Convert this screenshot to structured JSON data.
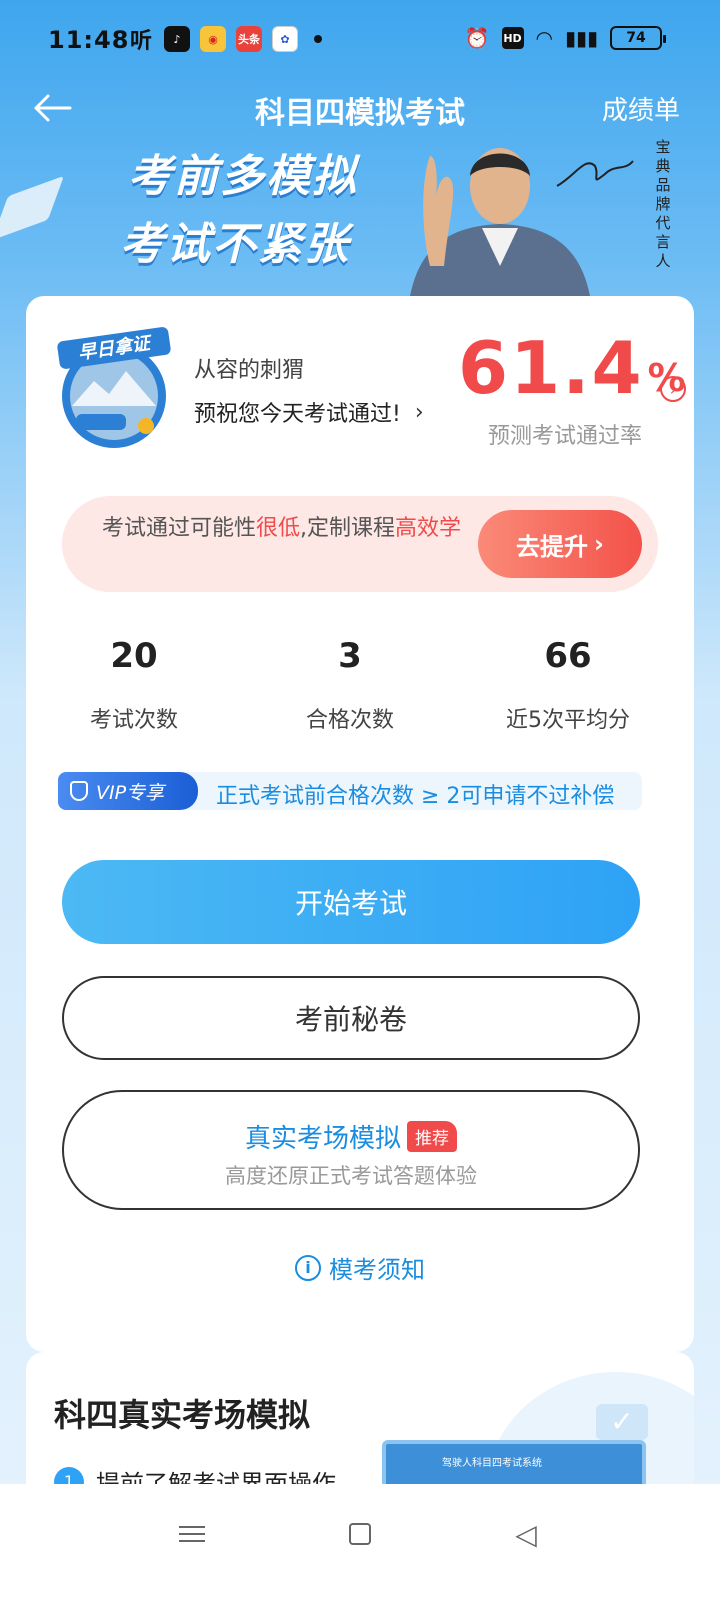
{
  "status_bar": {
    "time": "11:48",
    "left_icons": [
      "ting-icon",
      "douyin-icon",
      "weibo-icon",
      "toutiao-icon",
      "baidu-icon"
    ],
    "toutiao_label": "头条",
    "battery": "74"
  },
  "nav": {
    "title": "科目四模拟考试",
    "right_label": "成绩单"
  },
  "banner": {
    "line1": "考前多模拟",
    "line2": "考试不紧张",
    "spokes_label": "宝典品牌代言人"
  },
  "profile": {
    "badge_text": "早日拿证",
    "user_name": "从容的刺猬",
    "wish": "预祝您今天考试通过!",
    "pass_rate_value": "61.4",
    "pass_rate_unit": "%",
    "pass_rate_label": "预测考试通过率"
  },
  "promo": {
    "text_before": "考试通过可能性",
    "text_highlight1": "很低",
    "text_middle": ",定制课程",
    "text_highlight2": "高效学",
    "button_label": "去提升"
  },
  "stats": [
    {
      "value": "20",
      "label": "考试次数"
    },
    {
      "value": "3",
      "label": "合格次数"
    },
    {
      "value": "66",
      "label": "近5次平均分"
    }
  ],
  "vip": {
    "tag": "VIP专享",
    "text": "正式考试前合格次数 ≥ 2可申请不过补偿"
  },
  "buttons": {
    "start": "开始考试",
    "secret": "考前秘卷",
    "sim_title": "真实考场模拟",
    "sim_tag": "推荐",
    "sim_sub": "高度还原正式考试答题体验",
    "notice": "模考须知"
  },
  "card2": {
    "title": "科四真实考场模拟",
    "item_num": "1",
    "item_text": "提前了解考试界面操作",
    "screen_title": "驾驶人科目四考试系统"
  },
  "colors": {
    "accent_blue": "#2ea2f5",
    "alert_red": "#f04a4a",
    "link_blue": "#1b8de0"
  }
}
